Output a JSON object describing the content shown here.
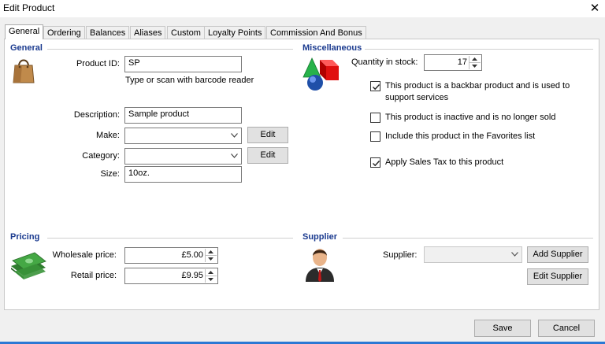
{
  "window": {
    "title": "Edit Product",
    "close_icon": "close-icon"
  },
  "tabs": [
    {
      "label": "General",
      "active": true
    },
    {
      "label": "Ordering"
    },
    {
      "label": "Balances"
    },
    {
      "label": "Aliases"
    },
    {
      "label": "Custom"
    },
    {
      "label": "Loyalty Points"
    },
    {
      "label": "Commission And Bonus"
    }
  ],
  "general": {
    "heading": "General",
    "icon": "shopping-bag-icon",
    "product_id_label": "Product ID:",
    "product_id_value": "SP",
    "product_id_hint": "Type or scan with barcode reader",
    "description_label": "Description:",
    "description_value": "Sample product",
    "make_label": "Make:",
    "make_value": "",
    "make_edit_label": "Edit",
    "category_label": "Category:",
    "category_value": "",
    "category_edit_label": "Edit",
    "size_label": "Size:",
    "size_value": "10oz."
  },
  "misc": {
    "heading": "Miscellaneous",
    "icon": "shapes-icon",
    "quantity_label": "Quantity in stock:",
    "quantity_value": "17",
    "checkboxes": [
      {
        "label_line1": "This product is a backbar product and is used to",
        "label_line2": "support services",
        "checked": true
      },
      {
        "label": "This product is inactive and is no longer sold",
        "checked": false
      },
      {
        "label": "Include this product in the Favorites list",
        "checked": false
      },
      {
        "label": "Apply Sales Tax to this product",
        "checked": true
      }
    ]
  },
  "pricing": {
    "heading": "Pricing",
    "icon": "money-stack-icon",
    "wholesale_label": "Wholesale price:",
    "wholesale_value": "£5.00",
    "retail_label": "Retail price:",
    "retail_value": "£9.95"
  },
  "supplier": {
    "heading": "Supplier",
    "icon": "person-icon",
    "supplier_label": "Supplier:",
    "supplier_value": "",
    "add_label": "Add Supplier",
    "edit_label": "Edit Supplier"
  },
  "footer": {
    "save_label": "Save",
    "cancel_label": "Cancel"
  },
  "colors": {
    "section_heading": "#1a3a8f",
    "accent": "#2b78d4"
  }
}
